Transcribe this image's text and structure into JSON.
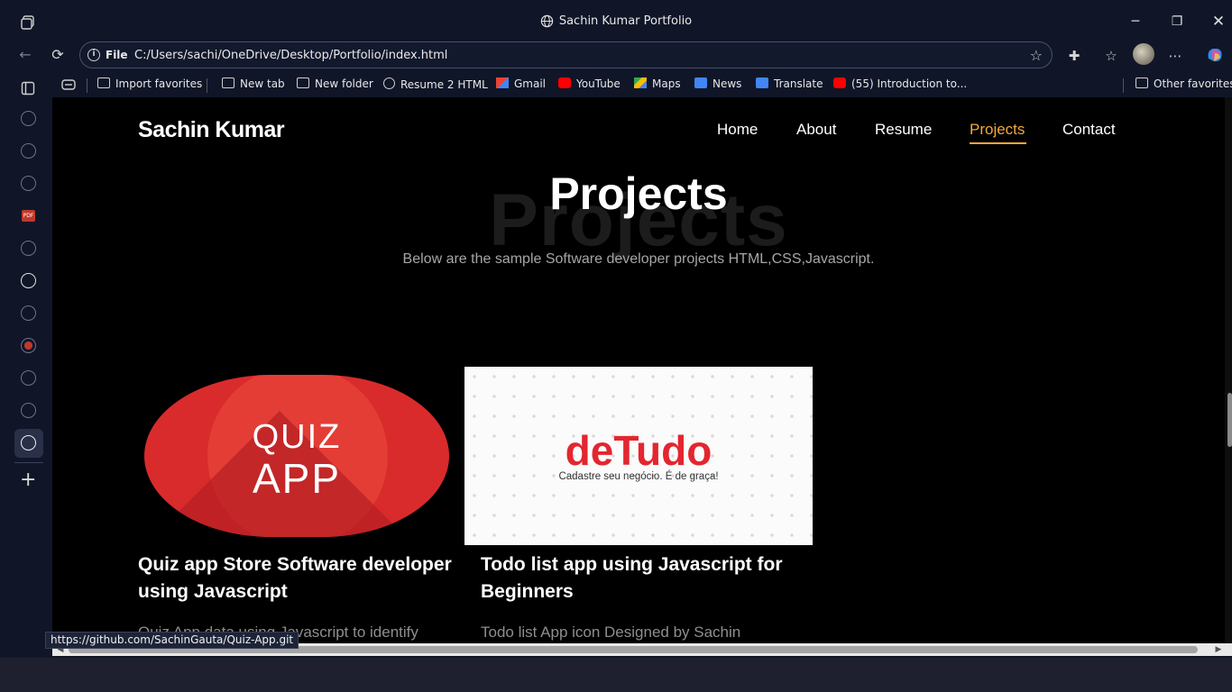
{
  "window": {
    "title": "Sachin Kumar Portfolio"
  },
  "address": {
    "scheme": "File",
    "url": "C:/Users/sachi/OneDrive/Desktop/Portfolio/index.html"
  },
  "favorites": [
    {
      "label": "Import favorites",
      "icon": "import-icon"
    },
    {
      "label": "New tab",
      "icon": "tab-icon"
    },
    {
      "label": "New folder",
      "icon": "folder-icon"
    },
    {
      "label": "Resume 2 HTML",
      "icon": "globe-icon"
    },
    {
      "label": "Gmail",
      "icon": "gmail-icon"
    },
    {
      "label": "YouTube",
      "icon": "youtube-icon"
    },
    {
      "label": "Maps",
      "icon": "maps-icon"
    },
    {
      "label": "News",
      "icon": "news-icon"
    },
    {
      "label": "Translate",
      "icon": "translate-icon"
    },
    {
      "label": "(55) Introduction to...",
      "icon": "youtube-icon"
    }
  ],
  "other_favorites": "Other favorites",
  "site": {
    "logo": "Sachin Kumar",
    "nav": [
      "Home",
      "About",
      "Resume",
      "Projects",
      "Contact"
    ],
    "active_nav": "Projects",
    "accent": "#f2a93b"
  },
  "section": {
    "ghost_title": "Projects",
    "title": "Projects",
    "subtitle": "Below are the sample Software developer projects HTML,CSS,Javascript."
  },
  "projects": [
    {
      "image_text_1": "QUIZ",
      "image_text_2": "APP",
      "title": "Quiz app Store Software developer using Javascript",
      "desc": "Quiz App data using Javascript to identify"
    },
    {
      "image_brand": "deTudo",
      "image_tag": "Cadastre seu negócio. É de graça!",
      "title": "Todo list app using Javascript for Beginners",
      "desc": "Todo list App icon Designed by Sachin"
    }
  ],
  "status_url": "https://github.com/SachinGauta/Quiz-App.git"
}
